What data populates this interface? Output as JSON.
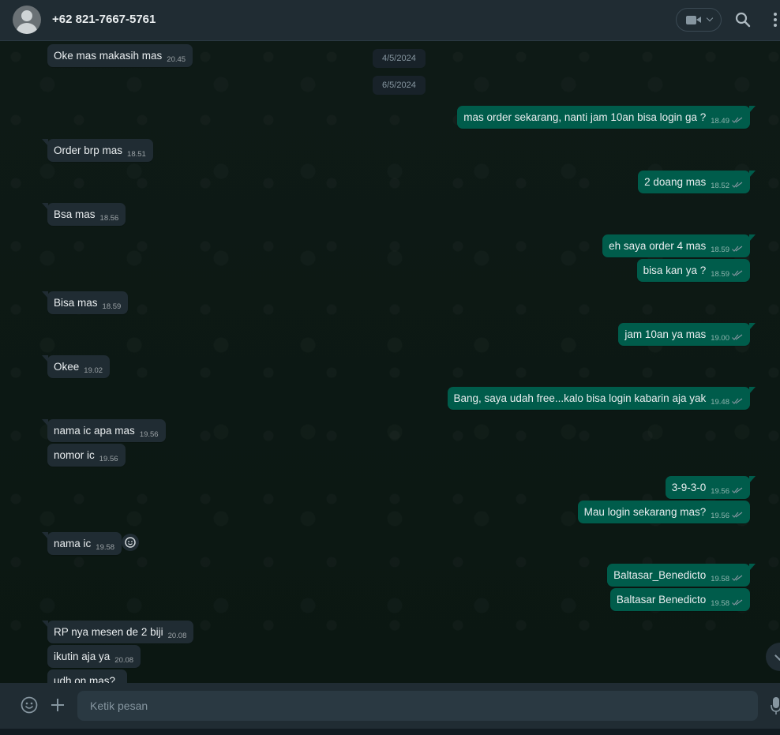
{
  "header": {
    "contact_name": "+62 821-7667-5761",
    "icons": [
      "avatar",
      "video-call-icon",
      "search-icon",
      "menu-icon"
    ]
  },
  "dates": [
    "4/5/2024",
    "6/5/2024"
  ],
  "messages": [
    {
      "direction": "in",
      "text": "Oke mas makasih mas",
      "time": "20.45"
    },
    {
      "direction": "out",
      "text": "mas order sekarang, nanti jam 10an bisa login ga ?",
      "time": "18.49"
    },
    {
      "direction": "in",
      "text": "Order brp mas",
      "time": "18.51"
    },
    {
      "direction": "out",
      "text": "2 doang mas",
      "time": "18.52"
    },
    {
      "direction": "in",
      "text": "Bsa mas",
      "time": "18.56"
    },
    {
      "direction": "out",
      "text": "eh saya order 4 mas",
      "time": "18.59"
    },
    {
      "direction": "out",
      "text": "bisa kan ya ?",
      "time": "18.59"
    },
    {
      "direction": "in",
      "text": "Bisa mas",
      "time": "18.59"
    },
    {
      "direction": "out",
      "text": "jam 10an ya mas",
      "time": "19.00"
    },
    {
      "direction": "in",
      "text": "Okee",
      "time": "19.02"
    },
    {
      "direction": "out",
      "text": "Bang, saya udah free...kalo bisa login kabarin aja yak",
      "time": "19.48"
    },
    {
      "direction": "in",
      "text": "nama ic apa mas",
      "time": "19.56"
    },
    {
      "direction": "in",
      "text": "nomor ic",
      "time": "19.56"
    },
    {
      "direction": "out",
      "text": "3-9-3-0",
      "time": "19.56"
    },
    {
      "direction": "out",
      "text": "Mau login sekarang mas?",
      "time": "19.56"
    },
    {
      "direction": "in",
      "text": "nama ic",
      "time": "19.58"
    },
    {
      "direction": "out",
      "text": "Baltasar_Benedicto",
      "time": "19.58"
    },
    {
      "direction": "out",
      "text": "Baltasar Benedicto",
      "time": "19.58"
    },
    {
      "direction": "in",
      "text": "RP nya mesen de 2 biji",
      "time": "20.08"
    },
    {
      "direction": "in",
      "text": "ikutin aja ya",
      "time": "20.08"
    },
    {
      "direction": "in",
      "text": "udh on mas?",
      "time": ""
    }
  ],
  "composer": {
    "placeholder": "Ketik pesan"
  },
  "colors": {
    "header_bg": "#202c33",
    "incoming_bubble": "#202c33",
    "outgoing_bubble": "#005c4b",
    "chat_bg": "#0b141a",
    "read_ticks": "#8696a0"
  }
}
